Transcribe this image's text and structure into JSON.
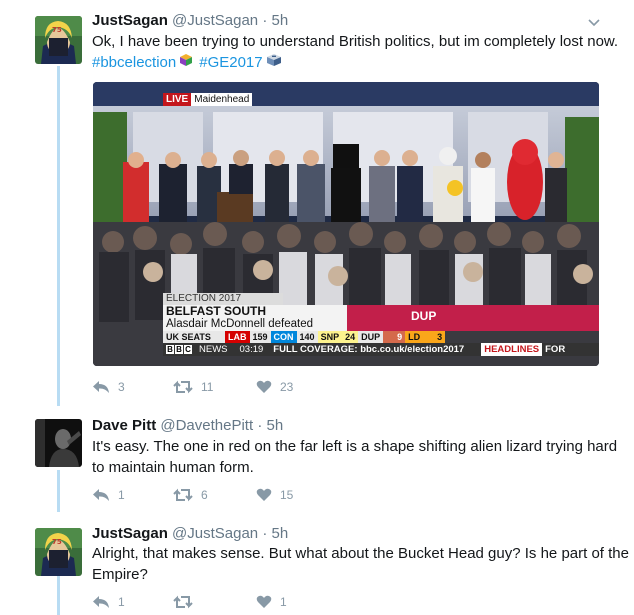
{
  "tweets": [
    {
      "name": "JustSagan",
      "handle": "@JustSagan",
      "time": "· 5h",
      "text": "Ok, I have been trying to understand British politics, but im completely lost now.",
      "hashtags": [
        "#bbcelection",
        "#GE2017"
      ],
      "replies": "3",
      "retweets": "11",
      "likes": "23"
    },
    {
      "name": "Dave Pitt",
      "handle": "@DavethePitt",
      "time": "· 5h",
      "text_lines": [
        "It's easy. The one in red on the far left is a shape shifting alien lizard trying hard",
        "to maintain human form."
      ],
      "replies": "1",
      "retweets": "6",
      "likes": "15"
    },
    {
      "name": "JustSagan",
      "handle": "@JustSagan",
      "time": "· 5h",
      "text_lines": [
        "Alright, that makes sense. But what about the Bucket Head guy? Is he part of the",
        "Empire?"
      ],
      "replies": "1",
      "retweets": "",
      "likes": "1"
    }
  ],
  "broadcast": {
    "live_label": "LIVE",
    "location": "Maidenhead",
    "strap_top": "ELECTION 2017",
    "headline": "BELFAST SOUTH",
    "subline": "Alasdair McDonnell defeated",
    "party_flag": "DUP",
    "seats": {
      "label": "UK SEATS",
      "items": [
        {
          "party": "LAB",
          "count": "159",
          "color": "#d50000"
        },
        {
          "party": "CON",
          "count": "140",
          "color": "#0087dc"
        },
        {
          "party": "SNP",
          "count": "24",
          "color": "#fdf38e"
        },
        {
          "party": "DUP",
          "count": "9",
          "color": "#d46a4c"
        },
        {
          "party": "LD",
          "count": "3",
          "color": "#faa61a"
        }
      ]
    },
    "ticker": {
      "brand": "NEWS",
      "clock": "03:19",
      "coverage": "FULL COVERAGE: bbc.co.uk/election2017",
      "headlines": "HEADLINES",
      "trail": "FOR"
    }
  },
  "colors": {
    "thread_line": "#b8dcf3",
    "link": "#1b95e0",
    "muted": "#657786",
    "action_gray": "#8899a6"
  }
}
